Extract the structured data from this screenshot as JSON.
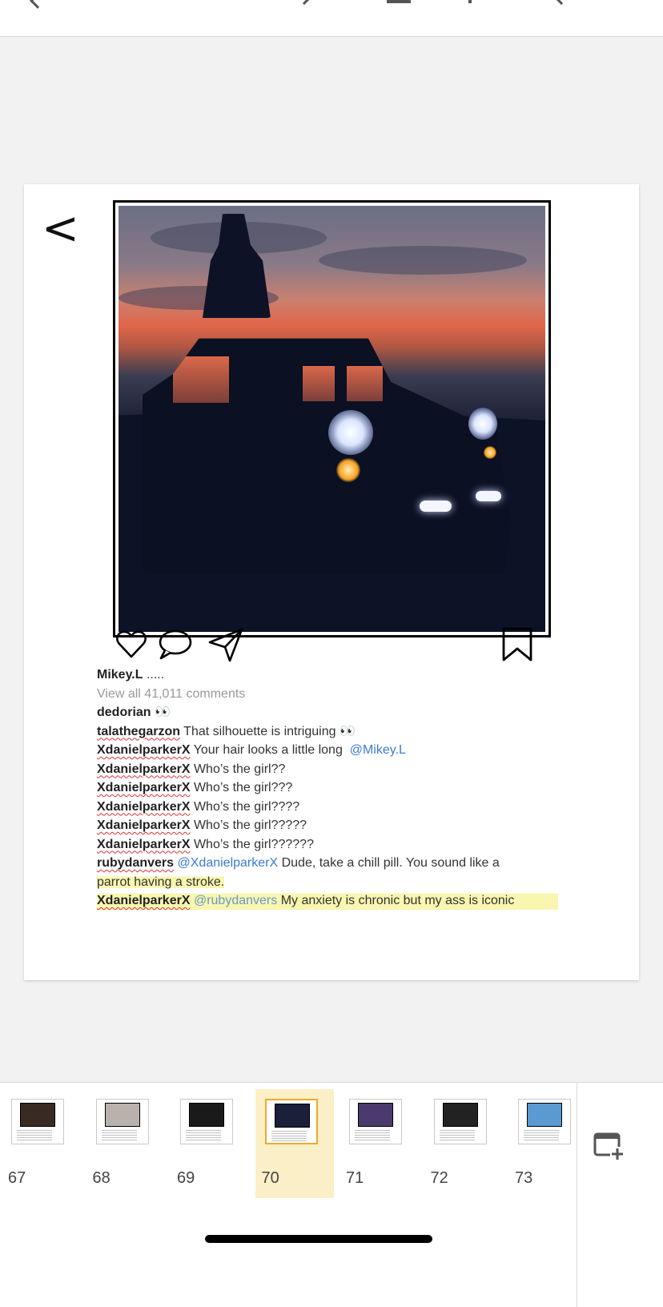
{
  "post": {
    "username": "Mikey.L",
    "caption_tail": ".....",
    "view_all": "View all 41,011 comments",
    "comments": [
      {
        "user": "dedorian",
        "mention": "",
        "text": "👀"
      },
      {
        "user": "talathegarzon",
        "mention": "",
        "text": "That silhouette is intriguing 👀"
      },
      {
        "user": "XdanielparkerX",
        "mention": "",
        "text": "Your hair looks a little long",
        "mention_after": "@Mikey.L"
      },
      {
        "user": "XdanielparkerX",
        "mention": "",
        "text": "Who’s the girl??"
      },
      {
        "user": "XdanielparkerX",
        "mention": "",
        "text": "Who’s the girl???"
      },
      {
        "user": "XdanielparkerX",
        "mention": "",
        "text": "Who’s the girl????"
      },
      {
        "user": "XdanielparkerX",
        "mention": "",
        "text": "Who’s the girl?????"
      },
      {
        "user": "XdanielparkerX",
        "mention": "",
        "text": "Who’s the girl??????"
      },
      {
        "user": "rubydanvers",
        "mention": "@XdanielparkerX",
        "text": "Dude, take a chill pill. You sound like a",
        "text_cont": "parrot having a stroke."
      },
      {
        "user": "XdanielparkerX",
        "mention": "@rubydanvers",
        "text": "My anxiety is chronic but my ass is iconic"
      }
    ],
    "back_glyph": "<"
  },
  "thumbnails": [
    {
      "number": "67",
      "img_color": "#3a2a24"
    },
    {
      "number": "68",
      "img_color": "#b9b2ac"
    },
    {
      "number": "69",
      "img_color": "#1a1a1a"
    },
    {
      "number": "70",
      "img_color": "#1a1f3a",
      "active": true
    },
    {
      "number": "71",
      "img_color": "#4a3a6e"
    },
    {
      "number": "72",
      "img_color": "#222222"
    },
    {
      "number": "73",
      "img_color": "#5a9ad0"
    }
  ],
  "colors": {
    "mention": "#3b7bd4",
    "highlight": "#f2ee6e",
    "active_thumb_bg": "#fbefc7",
    "active_thumb_border": "#f0a92a"
  },
  "icons": [
    "heart-icon",
    "comment-icon",
    "send-icon",
    "bookmark-icon",
    "add-slide-icon"
  ]
}
